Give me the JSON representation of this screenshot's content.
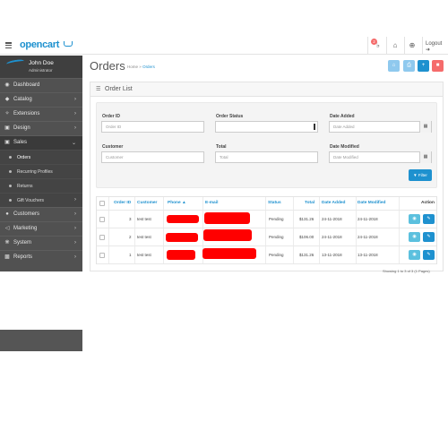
{
  "header": {
    "brand": "opencart",
    "logout_label": "Logout",
    "notification_count": "2",
    "icons": [
      "hamburger-icon",
      "bell-icon",
      "home-icon",
      "life-ring-icon",
      "sign-out-icon"
    ]
  },
  "sidebar": {
    "user_name": "John Doe",
    "user_role": "Administrator",
    "items": [
      {
        "label": "Dashboard",
        "icon": "dashboard-icon",
        "chevron": false
      },
      {
        "label": "Catalog",
        "icon": "tag-icon",
        "chevron": true
      },
      {
        "label": "Extensions",
        "icon": "puzzle-icon",
        "chevron": true
      },
      {
        "label": "Design",
        "icon": "tv-icon",
        "chevron": true
      },
      {
        "label": "Sales",
        "icon": "cart-icon",
        "chevron": true
      }
    ],
    "sales_subitems": [
      {
        "label": "Orders"
      },
      {
        "label": "Recurring Profiles"
      },
      {
        "label": "Returns"
      },
      {
        "label": "Gift Vouchers"
      }
    ],
    "items_after": [
      {
        "label": "Customers",
        "icon": "user-icon"
      },
      {
        "label": "Marketing",
        "icon": "share-icon"
      },
      {
        "label": "System",
        "icon": "cog-icon"
      },
      {
        "label": "Reports",
        "icon": "bar-chart-icon"
      }
    ]
  },
  "page": {
    "title": "Orders",
    "breadcrumb_home": "Home",
    "breadcrumb_sep": "»",
    "breadcrumb_current": "Orders",
    "toolbar_colors": {
      "home": "#8fc9ee",
      "print": "#8fc9ee",
      "add": "#1e91cf",
      "delete": "#f56b6b"
    }
  },
  "panel": {
    "title": "Order List"
  },
  "filter": {
    "order_id_label": "Order ID",
    "order_id_placeholder": "Order ID",
    "customer_label": "Customer",
    "customer_placeholder": "Customer",
    "order_status_label": "Order Status",
    "order_status_value": "",
    "total_label": "Total",
    "total_placeholder": "Total",
    "date_added_label": "Date Added",
    "date_added_placeholder": "Date Added",
    "date_modified_label": "Date Modified",
    "date_modified_placeholder": "Date Modified",
    "filter_button": "Filter"
  },
  "table": {
    "columns": [
      "Order ID",
      "Customer",
      "Phone ▲",
      "E-mail",
      "Status",
      "Total",
      "Date Added",
      "Date Modified",
      "Action"
    ],
    "rows": [
      {
        "order_id": "3",
        "customer": "test test",
        "status": "Pending",
        "total": "$131.26",
        "date_added": "24-11-2018",
        "date_modified": "24-11-2018"
      },
      {
        "order_id": "2",
        "customer": "test test",
        "status": "Pending",
        "total": "$106.00",
        "date_added": "24-11-2018",
        "date_modified": "24-11-2018"
      },
      {
        "order_id": "1",
        "customer": "test test",
        "status": "Pending",
        "total": "$131.26",
        "date_added": "13-11-2018",
        "date_modified": "13-11-2018"
      }
    ],
    "pagination_text": "Showing 1 to 3 of 3 (1 Pages)"
  }
}
